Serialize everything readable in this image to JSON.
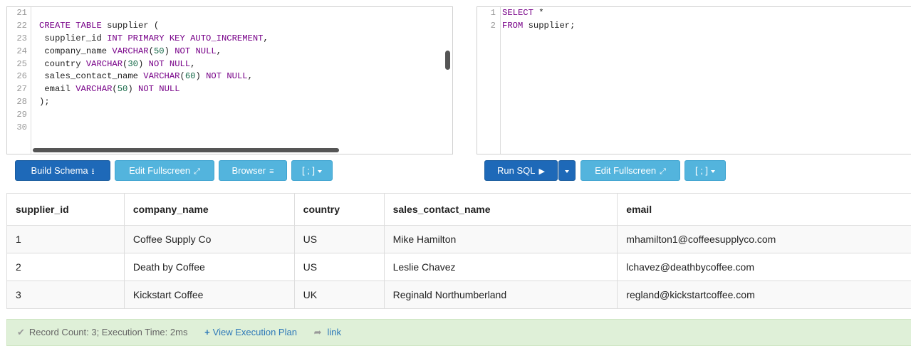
{
  "schema_editor": {
    "lines": [
      {
        "no": "21",
        "tokens": []
      },
      {
        "no": "22",
        "tokens": [
          {
            "t": "kw",
            "v": "CREATE TABLE"
          },
          {
            "t": "p",
            "v": " supplier ("
          }
        ]
      },
      {
        "no": "23",
        "tokens": [
          {
            "t": "p",
            "v": " supplier_id "
          },
          {
            "t": "kw",
            "v": "INT PRIMARY KEY AUTO_INCREMENT"
          },
          {
            "t": "p",
            "v": ","
          }
        ]
      },
      {
        "no": "24",
        "tokens": [
          {
            "t": "p",
            "v": " company_name "
          },
          {
            "t": "kw",
            "v": "VARCHAR"
          },
          {
            "t": "p",
            "v": "("
          },
          {
            "t": "num",
            "v": "50"
          },
          {
            "t": "p",
            "v": ") "
          },
          {
            "t": "kw",
            "v": "NOT NULL"
          },
          {
            "t": "p",
            "v": ","
          }
        ]
      },
      {
        "no": "25",
        "tokens": [
          {
            "t": "p",
            "v": " country "
          },
          {
            "t": "kw",
            "v": "VARCHAR"
          },
          {
            "t": "p",
            "v": "("
          },
          {
            "t": "num",
            "v": "30"
          },
          {
            "t": "p",
            "v": ") "
          },
          {
            "t": "kw",
            "v": "NOT NULL"
          },
          {
            "t": "p",
            "v": ","
          }
        ]
      },
      {
        "no": "26",
        "tokens": [
          {
            "t": "p",
            "v": " sales_contact_name "
          },
          {
            "t": "kw",
            "v": "VARCHAR"
          },
          {
            "t": "p",
            "v": "("
          },
          {
            "t": "num",
            "v": "60"
          },
          {
            "t": "p",
            "v": ") "
          },
          {
            "t": "kw",
            "v": "NOT NULL"
          },
          {
            "t": "p",
            "v": ","
          }
        ]
      },
      {
        "no": "27",
        "tokens": [
          {
            "t": "p",
            "v": " email "
          },
          {
            "t": "kw",
            "v": "VARCHAR"
          },
          {
            "t": "p",
            "v": "("
          },
          {
            "t": "num",
            "v": "50"
          },
          {
            "t": "p",
            "v": ") "
          },
          {
            "t": "kw",
            "v": "NOT NULL"
          }
        ]
      },
      {
        "no": "28",
        "tokens": [
          {
            "t": "p",
            "v": ");"
          }
        ]
      },
      {
        "no": "29",
        "tokens": []
      },
      {
        "no": "30",
        "tokens": []
      }
    ]
  },
  "query_editor": {
    "lines": [
      {
        "no": "1",
        "tokens": [
          {
            "t": "kw",
            "v": "SELECT"
          },
          {
            "t": "p",
            "v": " *"
          }
        ]
      },
      {
        "no": "2",
        "tokens": [
          {
            "t": "kw",
            "v": "FROM"
          },
          {
            "t": "p",
            "v": " supplier;"
          }
        ]
      }
    ]
  },
  "schema_toolbar": {
    "build_schema": "Build Schema",
    "build_schema_icon": "download-icon",
    "edit_fullscreen": "Edit Fullscreen",
    "edit_fullscreen_icon": "expand-icon",
    "browser": "Browser",
    "browser_icon": "tree-icon",
    "terminator": "[ ; ]"
  },
  "query_toolbar": {
    "run_sql": "Run SQL",
    "run_sql_icon": "play-icon",
    "edit_fullscreen": "Edit Fullscreen",
    "edit_fullscreen_icon": "expand-icon",
    "terminator": "[ ; ]"
  },
  "results": {
    "columns": [
      "supplier_id",
      "company_name",
      "country",
      "sales_contact_name",
      "email"
    ],
    "rows": [
      [
        "1",
        "Coffee Supply Co",
        "US",
        "Mike Hamilton",
        "mhamilton1@coffeesupplyco.com"
      ],
      [
        "2",
        "Death by Coffee",
        "US",
        "Leslie Chavez",
        "lchavez@deathbycoffee.com"
      ],
      [
        "3",
        "Kickstart Coffee",
        "UK",
        "Reginald Northumberland",
        "regland@kickstartcoffee.com"
      ]
    ]
  },
  "status": {
    "message": "Record Count: 3; Execution Time: 2ms",
    "view_plan": "View Execution Plan",
    "link": "link"
  },
  "colors": {
    "primary_button": "#1e69b8",
    "info_button": "#53b4dd",
    "status_background": "#dff0d8",
    "keyword": "#770088",
    "number": "#116644"
  }
}
